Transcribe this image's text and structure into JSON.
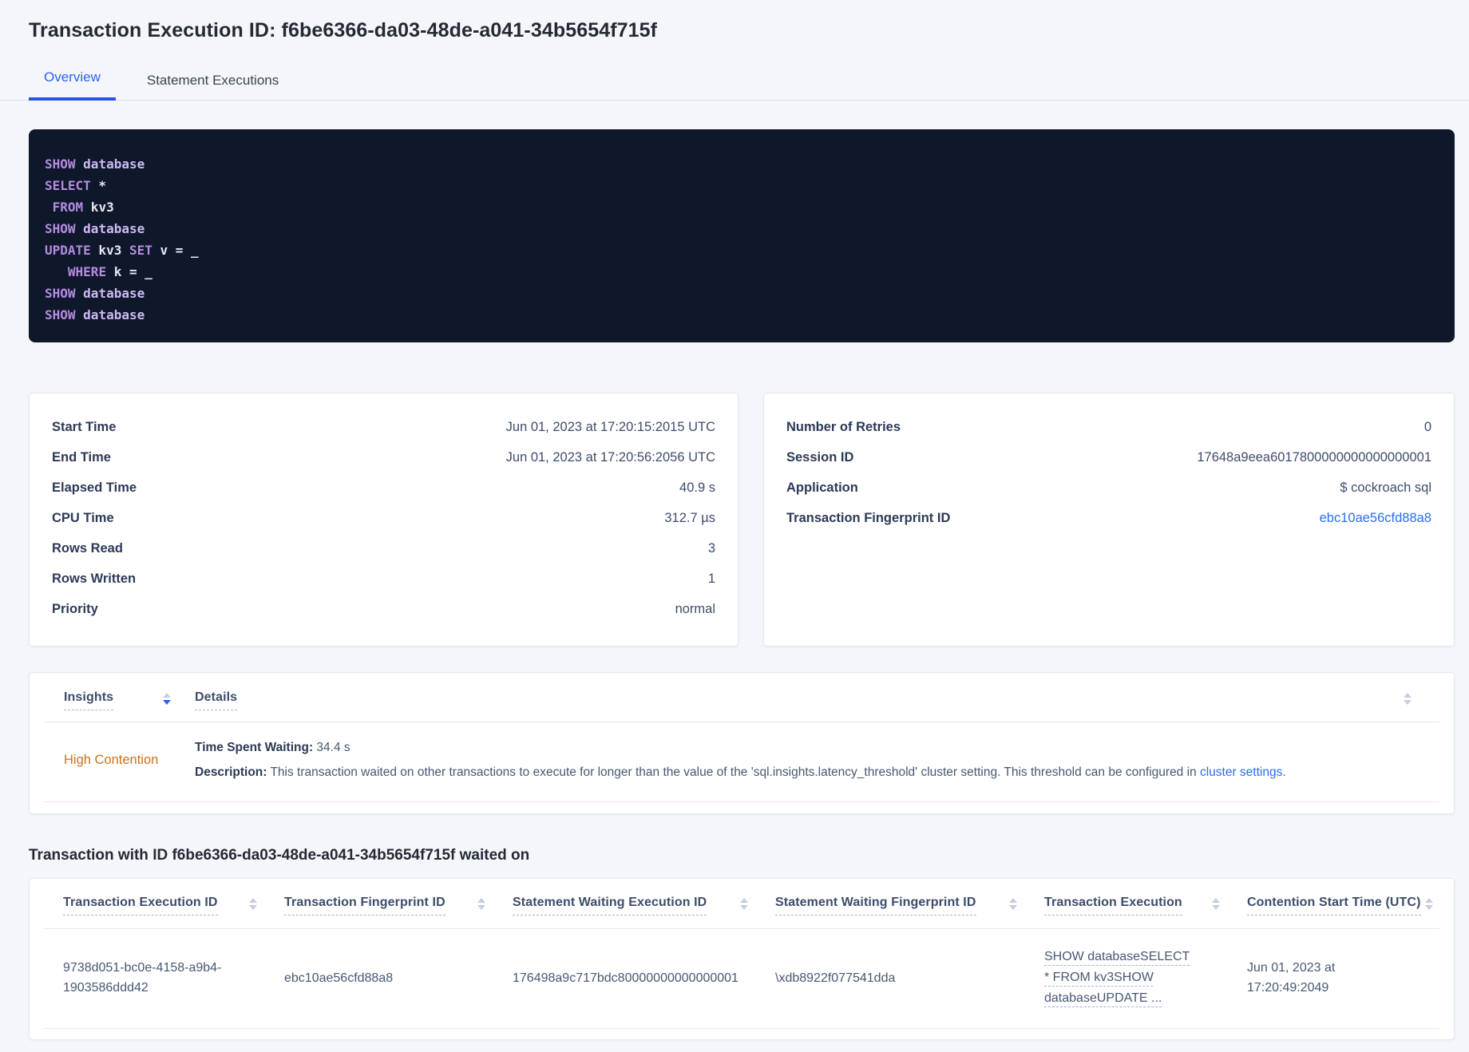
{
  "page": {
    "title": "Transaction Execution ID: f6be6366-da03-48de-a041-34b5654f715f"
  },
  "tabs": [
    {
      "label": "Overview",
      "active": true
    },
    {
      "label": "Statement Executions",
      "active": false
    }
  ],
  "colors": {
    "accent_blue": "#2a63f0",
    "link_blue": "#2a6df4",
    "insight_orange": "#c8731d",
    "code_background": "#0f182b",
    "code_keyword": "#b58ae0",
    "code_keyword_secondary": "#cdb9f2"
  },
  "sql_box": {
    "lines": [
      [
        [
          "kw",
          "SHOW"
        ],
        [
          "txt",
          " "
        ],
        [
          "kw2",
          "database"
        ]
      ],
      [
        [
          "kw",
          "SELECT"
        ],
        [
          "txt",
          " *"
        ]
      ],
      [
        [
          "txt",
          " "
        ],
        [
          "kw",
          "FROM"
        ],
        [
          "txt",
          " kv3"
        ]
      ],
      [
        [
          "kw",
          "SHOW"
        ],
        [
          "txt",
          " "
        ],
        [
          "kw2",
          "database"
        ]
      ],
      [
        [
          "kw",
          "UPDATE"
        ],
        [
          "txt",
          " kv3 "
        ],
        [
          "kw",
          "SET"
        ],
        [
          "txt",
          " v = _"
        ]
      ],
      [
        [
          "txt",
          "   "
        ],
        [
          "kw",
          "WHERE"
        ],
        [
          "txt",
          " k = _"
        ]
      ],
      [
        [
          "kw",
          "SHOW"
        ],
        [
          "txt",
          " "
        ],
        [
          "kw2",
          "database"
        ]
      ],
      [
        [
          "kw",
          "SHOW"
        ],
        [
          "txt",
          " "
        ],
        [
          "kw2",
          "database"
        ]
      ]
    ]
  },
  "summary_left": {
    "rows": [
      {
        "name": "start-time",
        "label": "Start Time",
        "value": "Jun 01, 2023 at 17:20:15:2015 UTC"
      },
      {
        "name": "end-time",
        "label": "End Time",
        "value": "Jun 01, 2023 at 17:20:56:2056 UTC"
      },
      {
        "name": "elapsed-time",
        "label": "Elapsed Time",
        "value": "40.9 s"
      },
      {
        "name": "cpu-time",
        "label": "CPU Time",
        "value": "312.7 µs"
      },
      {
        "name": "rows-read",
        "label": "Rows Read",
        "value": "3"
      },
      {
        "name": "rows-written",
        "label": "Rows Written",
        "value": "1"
      },
      {
        "name": "priority",
        "label": "Priority",
        "value": "normal"
      }
    ]
  },
  "summary_right": {
    "rows": [
      {
        "name": "number-of-retries",
        "label": "Number of Retries",
        "value": "0"
      },
      {
        "name": "session-id",
        "label": "Session ID",
        "value": "17648a9eea6017800000000000000001"
      },
      {
        "name": "application",
        "label": "Application",
        "value": "$ cockroach sql"
      },
      {
        "name": "transaction-fingerprint-id",
        "label": "Transaction Fingerprint ID",
        "value": "ebc10ae56cfd88a8",
        "link": true
      }
    ]
  },
  "insights": {
    "columns": [
      "Insights",
      "Details"
    ],
    "row": {
      "insight": "High Contention",
      "waiting_label": "Time Spent Waiting:",
      "waiting_value": " 34.4 s",
      "description_label": "Description:",
      "description_text": " This transaction waited on other transactions to execute for longer than the value of the 'sql.insights.latency_threshold' cluster setting. This threshold can be configured in ",
      "description_link": "cluster settings",
      "description_suffix": "."
    }
  },
  "waited_section": {
    "title": "Transaction with ID f6be6366-da03-48de-a041-34b5654f715f waited on",
    "columns": [
      "Transaction Execution ID",
      "Transaction Fingerprint ID",
      "Statement Waiting Execution ID",
      "Statement Waiting Fingerprint ID",
      "Transaction Execution",
      "Contention Start Time (UTC)"
    ],
    "row": {
      "transaction_execution_id": "9738d051-bc0e-4158-a9b4-1903586ddd42",
      "transaction_fingerprint_id": "ebc10ae56cfd88a8",
      "statement_waiting_execution_id": "176498a9c717bdc80000000000000001",
      "statement_waiting_fingerprint_id": "\\xdb8922f077541dda",
      "transaction_execution": "SHOW databaseSELECT * FROM kv3SHOW databaseUPDATE ...",
      "contention_start_time": "Jun 01, 2023 at 17:20:49:2049"
    }
  }
}
